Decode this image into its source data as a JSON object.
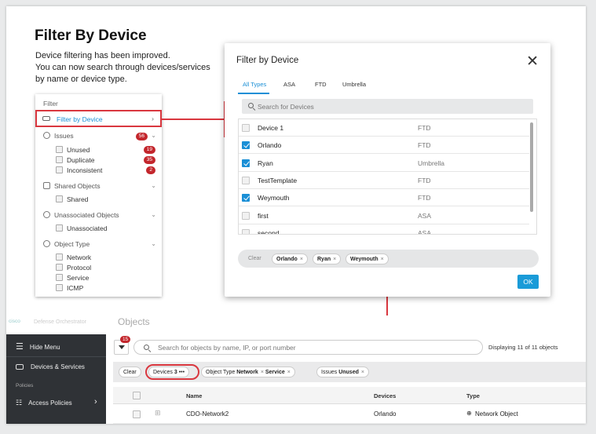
{
  "intro": {
    "title": "Filter By Device",
    "lines": [
      "Device filtering has been improved.",
      "You can now search through devices/services",
      "by name or device type."
    ]
  },
  "filter_panel": {
    "header": "Filter",
    "filter_by_device": "Filter by Device",
    "issues": {
      "label": "Issues",
      "count": "56",
      "items": [
        {
          "label": "Unused",
          "count": "19"
        },
        {
          "label": "Duplicate",
          "count": "35"
        },
        {
          "label": "Inconsistent",
          "count": "2"
        }
      ]
    },
    "shared_objects": {
      "label": "Shared Objects",
      "items": [
        "Shared"
      ]
    },
    "unassociated": {
      "label": "Unassociated Objects",
      "items": [
        "Unassociated"
      ]
    },
    "object_type": {
      "label": "Object Type",
      "items": [
        "Network",
        "Protocol",
        "Service",
        "ICMP"
      ]
    }
  },
  "dialog": {
    "title": "Filter by Device",
    "tabs": [
      "All Types",
      "ASA",
      "FTD",
      "Umbrella"
    ],
    "search_placeholder": "Search for Devices",
    "devices": [
      {
        "name": "Device 1",
        "type": "FTD",
        "checked": false
      },
      {
        "name": "Orlando",
        "type": "FTD",
        "checked": true
      },
      {
        "name": "Ryan",
        "type": "Umbrella",
        "checked": true
      },
      {
        "name": "TestTemplate",
        "type": "FTD",
        "checked": false
      },
      {
        "name": "Weymouth",
        "type": "FTD",
        "checked": true
      },
      {
        "name": "first",
        "type": "ASA",
        "checked": false
      },
      {
        "name": "second",
        "type": "ASA",
        "checked": false
      }
    ],
    "clear_label": "Clear",
    "chips": [
      "Orlando",
      "Ryan",
      "Weymouth"
    ],
    "ok_label": "OK"
  },
  "app": {
    "logo": "cisco",
    "logo_sub": "Defense Orchestrator",
    "page_title": "Objects",
    "sidebar": {
      "hide_menu": "Hide Menu",
      "devices_services": "Devices & Services",
      "section_policies": "Policies",
      "access_policies": "Access Policies"
    },
    "filter_badge": "15",
    "search_placeholder": "Search for objects by name, IP, or port number",
    "displaying": "Displaying 11 of 11 objects",
    "chips": {
      "clear": "Clear",
      "devices_label": "Devices",
      "devices_count": "3",
      "devices_more": "•••",
      "object_type_label": "Object Type",
      "object_type_values": [
        "Network",
        "Service"
      ],
      "issues_label": "Issues",
      "issues_value": "Unused"
    },
    "table": {
      "columns": [
        "Name",
        "Devices",
        "Type"
      ],
      "rows": [
        {
          "name": "CDO-Network2",
          "devices": "Orlando",
          "type": "Network Object"
        }
      ]
    }
  },
  "colors": {
    "accent": "#1a8fd6",
    "highlight": "#d9373f",
    "badge": "#c3262c",
    "sidebar": "#2f3236"
  }
}
